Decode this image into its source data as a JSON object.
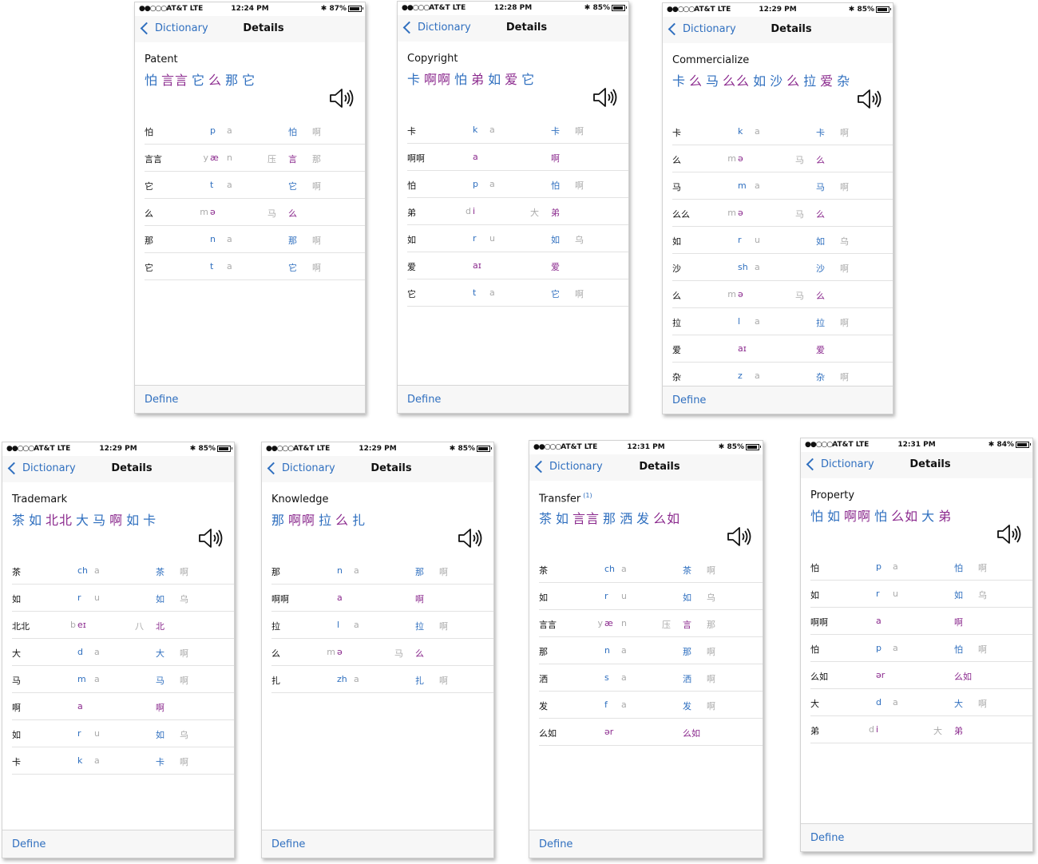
{
  "colors": {
    "blue": "#2f6fbf",
    "purple": "#8b2a8e",
    "gray": "#aaaaaa"
  },
  "icons": {
    "speaker": "speaker-icon",
    "back": "chevron-left-icon"
  },
  "nav": {
    "back_label": "Dictionary",
    "title": "Details"
  },
  "footer": {
    "define_label": "Define"
  },
  "screens": [
    {
      "status": {
        "carrier": "AT&T  LTE",
        "time": "12:24 PM",
        "battery": "87%"
      },
      "word": "Patent",
      "sup": "",
      "transcription": [
        {
          "t": "怕",
          "c": "b"
        },
        {
          "t": "言言",
          "c": "p"
        },
        {
          "t": "它",
          "c": "b"
        },
        {
          "t": "么",
          "c": "p"
        },
        {
          "t": "那",
          "c": "b"
        },
        {
          "t": "它",
          "c": "b"
        }
      ],
      "rows": [
        {
          "ch": "怕",
          "lc": "",
          "m": "p",
          "mc": "b",
          "rc": "a",
          "rl": "",
          "syl": "怕",
          "sc": "b",
          "t": "啊"
        },
        {
          "ch": "言言",
          "lc": "y",
          "m": "æ",
          "mc": "p",
          "rc": "n",
          "rl": "压",
          "syl": "言",
          "sc": "p",
          "t": "那"
        },
        {
          "ch": "它",
          "lc": "",
          "m": "t",
          "mc": "b",
          "rc": "a",
          "rl": "",
          "syl": "它",
          "sc": "b",
          "t": "啊"
        },
        {
          "ch": "么",
          "lc": "m",
          "m": "ə",
          "mc": "p",
          "rc": "",
          "rl": "马",
          "syl": "么",
          "sc": "p",
          "t": ""
        },
        {
          "ch": "那",
          "lc": "",
          "m": "n",
          "mc": "b",
          "rc": "a",
          "rl": "",
          "syl": "那",
          "sc": "b",
          "t": "啊"
        },
        {
          "ch": "它",
          "lc": "",
          "m": "t",
          "mc": "b",
          "rc": "a",
          "rl": "",
          "syl": "它",
          "sc": "b",
          "t": "啊"
        }
      ]
    },
    {
      "status": {
        "carrier": "AT&T  LTE",
        "time": "12:28 PM",
        "battery": "85%"
      },
      "word": "Copyright",
      "sup": "",
      "transcription": [
        {
          "t": "卡",
          "c": "b"
        },
        {
          "t": "啊啊",
          "c": "p"
        },
        {
          "t": "怕",
          "c": "b"
        },
        {
          "t": "弟",
          "c": "p"
        },
        {
          "t": "如",
          "c": "b"
        },
        {
          "t": "爱",
          "c": "p"
        },
        {
          "t": "它",
          "c": "b"
        }
      ],
      "rows": [
        {
          "ch": "卡",
          "lc": "",
          "m": "k",
          "mc": "b",
          "rc": "a",
          "rl": "",
          "syl": "卡",
          "sc": "b",
          "t": "啊"
        },
        {
          "ch": "啊啊",
          "lc": "",
          "m": "a",
          "mc": "p",
          "rc": "",
          "rl": "",
          "syl": "啊",
          "sc": "p",
          "t": ""
        },
        {
          "ch": "怕",
          "lc": "",
          "m": "p",
          "mc": "b",
          "rc": "a",
          "rl": "",
          "syl": "怕",
          "sc": "b",
          "t": "啊"
        },
        {
          "ch": "弟",
          "lc": "d",
          "m": "i",
          "mc": "p",
          "rc": "",
          "rl": "大",
          "syl": "弟",
          "sc": "p",
          "t": ""
        },
        {
          "ch": "如",
          "lc": "",
          "m": "r",
          "mc": "b",
          "rc": "u",
          "rl": "",
          "syl": "如",
          "sc": "b",
          "t": "乌"
        },
        {
          "ch": "爱",
          "lc": "",
          "m": "aɪ",
          "mc": "p",
          "rc": "",
          "rl": "",
          "syl": "爱",
          "sc": "p",
          "t": ""
        },
        {
          "ch": "它",
          "lc": "",
          "m": "t",
          "mc": "b",
          "rc": "a",
          "rl": "",
          "syl": "它",
          "sc": "b",
          "t": "啊"
        }
      ]
    },
    {
      "status": {
        "carrier": "AT&T  LTE",
        "time": "12:29 PM",
        "battery": "85%"
      },
      "word": "Commercialize",
      "sup": "",
      "transcription": [
        {
          "t": "卡",
          "c": "b"
        },
        {
          "t": "么",
          "c": "p"
        },
        {
          "t": "马",
          "c": "b"
        },
        {
          "t": "么么",
          "c": "p"
        },
        {
          "t": "如",
          "c": "b"
        },
        {
          "t": "沙",
          "c": "b"
        },
        {
          "t": "么",
          "c": "p"
        },
        {
          "t": "拉",
          "c": "b"
        },
        {
          "t": "爱",
          "c": "p"
        },
        {
          "t": "杂",
          "c": "b"
        }
      ],
      "rows": [
        {
          "ch": "卡",
          "lc": "",
          "m": "k",
          "mc": "b",
          "rc": "a",
          "rl": "",
          "syl": "卡",
          "sc": "b",
          "t": "啊"
        },
        {
          "ch": "么",
          "lc": "m",
          "m": "ə",
          "mc": "p",
          "rc": "",
          "rl": "马",
          "syl": "么",
          "sc": "p",
          "t": ""
        },
        {
          "ch": "马",
          "lc": "",
          "m": "m",
          "mc": "b",
          "rc": "a",
          "rl": "",
          "syl": "马",
          "sc": "b",
          "t": "啊"
        },
        {
          "ch": "么么",
          "lc": "m",
          "m": "ə",
          "mc": "p",
          "rc": "",
          "rl": "马",
          "syl": "么",
          "sc": "p",
          "t": ""
        },
        {
          "ch": "如",
          "lc": "",
          "m": "r",
          "mc": "b",
          "rc": "u",
          "rl": "",
          "syl": "如",
          "sc": "b",
          "t": "乌"
        },
        {
          "ch": "沙",
          "lc": "",
          "m": "sh",
          "mc": "b",
          "rc": "a",
          "rl": "",
          "syl": "沙",
          "sc": "b",
          "t": "啊"
        },
        {
          "ch": "么",
          "lc": "m",
          "m": "ə",
          "mc": "p",
          "rc": "",
          "rl": "马",
          "syl": "么",
          "sc": "p",
          "t": ""
        },
        {
          "ch": "拉",
          "lc": "",
          "m": "l",
          "mc": "b",
          "rc": "a",
          "rl": "",
          "syl": "拉",
          "sc": "b",
          "t": "啊"
        },
        {
          "ch": "爱",
          "lc": "",
          "m": "aɪ",
          "mc": "p",
          "rc": "",
          "rl": "",
          "syl": "爱",
          "sc": "p",
          "t": ""
        },
        {
          "ch": "杂",
          "lc": "",
          "m": "z",
          "mc": "b",
          "rc": "a",
          "rl": "",
          "syl": "杂",
          "sc": "b",
          "t": "啊"
        }
      ]
    },
    {
      "status": {
        "carrier": "AT&T  LTE",
        "time": "12:29 PM",
        "battery": "85%"
      },
      "word": "Trademark",
      "sup": "",
      "transcription": [
        {
          "t": "茶",
          "c": "b"
        },
        {
          "t": "如",
          "c": "b"
        },
        {
          "t": "北北",
          "c": "p"
        },
        {
          "t": "大",
          "c": "b"
        },
        {
          "t": "马",
          "c": "b"
        },
        {
          "t": "啊",
          "c": "p"
        },
        {
          "t": "如",
          "c": "b"
        },
        {
          "t": "卡",
          "c": "b"
        }
      ],
      "rows": [
        {
          "ch": "茶",
          "lc": "",
          "m": "ch",
          "mc": "b",
          "rc": "a",
          "rl": "",
          "syl": "茶",
          "sc": "b",
          "t": "啊"
        },
        {
          "ch": "如",
          "lc": "",
          "m": "r",
          "mc": "b",
          "rc": "u",
          "rl": "",
          "syl": "如",
          "sc": "b",
          "t": "乌"
        },
        {
          "ch": "北北",
          "lc": "b",
          "m": "eɪ",
          "mc": "p",
          "rc": "",
          "rl": "八",
          "syl": "北",
          "sc": "p",
          "t": ""
        },
        {
          "ch": "大",
          "lc": "",
          "m": "d",
          "mc": "b",
          "rc": "a",
          "rl": "",
          "syl": "大",
          "sc": "b",
          "t": "啊"
        },
        {
          "ch": "马",
          "lc": "",
          "m": "m",
          "mc": "b",
          "rc": "a",
          "rl": "",
          "syl": "马",
          "sc": "b",
          "t": "啊"
        },
        {
          "ch": "啊",
          "lc": "",
          "m": "a",
          "mc": "p",
          "rc": "",
          "rl": "",
          "syl": "啊",
          "sc": "p",
          "t": ""
        },
        {
          "ch": "如",
          "lc": "",
          "m": "r",
          "mc": "b",
          "rc": "u",
          "rl": "",
          "syl": "如",
          "sc": "b",
          "t": "乌"
        },
        {
          "ch": "卡",
          "lc": "",
          "m": "k",
          "mc": "b",
          "rc": "a",
          "rl": "",
          "syl": "卡",
          "sc": "b",
          "t": "啊"
        }
      ]
    },
    {
      "status": {
        "carrier": "AT&T  LTE",
        "time": "12:29 PM",
        "battery": "85%"
      },
      "word": "Knowledge",
      "sup": "",
      "transcription": [
        {
          "t": "那",
          "c": "b"
        },
        {
          "t": "啊啊",
          "c": "p"
        },
        {
          "t": "拉",
          "c": "b"
        },
        {
          "t": "么",
          "c": "p"
        },
        {
          "t": "扎",
          "c": "b"
        }
      ],
      "rows": [
        {
          "ch": "那",
          "lc": "",
          "m": "n",
          "mc": "b",
          "rc": "a",
          "rl": "",
          "syl": "那",
          "sc": "b",
          "t": "啊"
        },
        {
          "ch": "啊啊",
          "lc": "",
          "m": "a",
          "mc": "p",
          "rc": "",
          "rl": "",
          "syl": "啊",
          "sc": "p",
          "t": ""
        },
        {
          "ch": "拉",
          "lc": "",
          "m": "l",
          "mc": "b",
          "rc": "a",
          "rl": "",
          "syl": "拉",
          "sc": "b",
          "t": "啊"
        },
        {
          "ch": "么",
          "lc": "m",
          "m": "ə",
          "mc": "p",
          "rc": "",
          "rl": "马",
          "syl": "么",
          "sc": "p",
          "t": ""
        },
        {
          "ch": "扎",
          "lc": "",
          "m": "zh",
          "mc": "b",
          "rc": "a",
          "rl": "",
          "syl": "扎",
          "sc": "b",
          "t": "啊"
        }
      ]
    },
    {
      "status": {
        "carrier": "AT&T  LTE",
        "time": "12:31 PM",
        "battery": "85%"
      },
      "word": "Transfer",
      "sup": "(1)",
      "transcription": [
        {
          "t": "茶",
          "c": "b"
        },
        {
          "t": "如",
          "c": "b"
        },
        {
          "t": "言言",
          "c": "p"
        },
        {
          "t": "那",
          "c": "b"
        },
        {
          "t": "洒",
          "c": "b"
        },
        {
          "t": "发",
          "c": "b"
        },
        {
          "t": "么如",
          "c": "p"
        }
      ],
      "rows": [
        {
          "ch": "茶",
          "lc": "",
          "m": "ch",
          "mc": "b",
          "rc": "a",
          "rl": "",
          "syl": "茶",
          "sc": "b",
          "t": "啊"
        },
        {
          "ch": "如",
          "lc": "",
          "m": "r",
          "mc": "b",
          "rc": "u",
          "rl": "",
          "syl": "如",
          "sc": "b",
          "t": "乌"
        },
        {
          "ch": "言言",
          "lc": "y",
          "m": "æ",
          "mc": "p",
          "rc": "n",
          "rl": "压",
          "syl": "言",
          "sc": "p",
          "t": "那"
        },
        {
          "ch": "那",
          "lc": "",
          "m": "n",
          "mc": "b",
          "rc": "a",
          "rl": "",
          "syl": "那",
          "sc": "b",
          "t": "啊"
        },
        {
          "ch": "洒",
          "lc": "",
          "m": "s",
          "mc": "b",
          "rc": "a",
          "rl": "",
          "syl": "洒",
          "sc": "b",
          "t": "啊"
        },
        {
          "ch": "发",
          "lc": "",
          "m": "f",
          "mc": "b",
          "rc": "a",
          "rl": "",
          "syl": "发",
          "sc": "b",
          "t": "啊"
        },
        {
          "ch": "么如",
          "lc": "",
          "m": "ər",
          "mc": "p",
          "rc": "",
          "rl": "",
          "syl": "么如",
          "sc": "p",
          "t": ""
        }
      ]
    },
    {
      "status": {
        "carrier": "AT&T  LTE",
        "time": "12:31 PM",
        "battery": "84%"
      },
      "word": "Property",
      "sup": "",
      "transcription": [
        {
          "t": "怕",
          "c": "b"
        },
        {
          "t": "如",
          "c": "b"
        },
        {
          "t": "啊啊",
          "c": "p"
        },
        {
          "t": "怕",
          "c": "b"
        },
        {
          "t": "么如",
          "c": "p"
        },
        {
          "t": "大",
          "c": "b"
        },
        {
          "t": "弟",
          "c": "p"
        }
      ],
      "rows": [
        {
          "ch": "怕",
          "lc": "",
          "m": "p",
          "mc": "b",
          "rc": "a",
          "rl": "",
          "syl": "怕",
          "sc": "b",
          "t": "啊"
        },
        {
          "ch": "如",
          "lc": "",
          "m": "r",
          "mc": "b",
          "rc": "u",
          "rl": "",
          "syl": "如",
          "sc": "b",
          "t": "乌"
        },
        {
          "ch": "啊啊",
          "lc": "",
          "m": "a",
          "mc": "p",
          "rc": "",
          "rl": "",
          "syl": "啊",
          "sc": "p",
          "t": ""
        },
        {
          "ch": "怕",
          "lc": "",
          "m": "p",
          "mc": "b",
          "rc": "a",
          "rl": "",
          "syl": "怕",
          "sc": "b",
          "t": "啊"
        },
        {
          "ch": "么如",
          "lc": "",
          "m": "ər",
          "mc": "p",
          "rc": "",
          "rl": "",
          "syl": "么如",
          "sc": "p",
          "t": ""
        },
        {
          "ch": "大",
          "lc": "",
          "m": "d",
          "mc": "b",
          "rc": "a",
          "rl": "",
          "syl": "大",
          "sc": "b",
          "t": "啊"
        },
        {
          "ch": "弟",
          "lc": "d",
          "m": "i",
          "mc": "p",
          "rc": "",
          "rl": "大",
          "syl": "弟",
          "sc": "p",
          "t": ""
        }
      ]
    }
  ]
}
